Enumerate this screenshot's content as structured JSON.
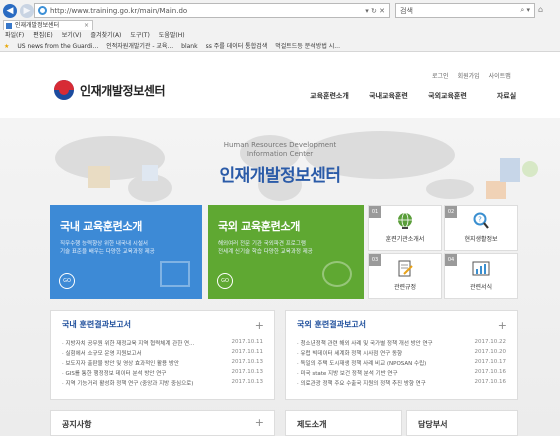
{
  "browser": {
    "url": "http://www.training.go.kr/main/Main.do",
    "search_query": "검색",
    "tab_title": "인재개발정보센터",
    "menu": [
      "파일(F)",
      "편집(E)",
      "보기(V)",
      "즐겨찾기(A)",
      "도구(T)",
      "도움말(H)"
    ],
    "favorites": [
      "US news from the Guardi...",
      "인적자원개발기관 - 교육...",
      "blank",
      "ss 주를 데이터 통합검색",
      "먹걸트드등 분석방법 시..."
    ]
  },
  "site": {
    "utility_links": [
      "로그인",
      "회원가입",
      "사이트맵"
    ],
    "logo_text": "인재개발정보센터",
    "gnb": [
      "교육훈련소개",
      "국내교육훈련",
      "국외교육훈련",
      "자료실"
    ],
    "hero_subtitle_1": "Human Resources Development",
    "hero_subtitle_2": "Information Center",
    "hero_title": "인재개발정보센터"
  },
  "boxes": {
    "domestic": {
      "title": "국내 교육훈련소개",
      "desc_1": "직무수행 능력향상 위한 내국내 시설서",
      "desc_2": "기술 표준을 배우는 다양한 교육과정 제공",
      "go": "GO"
    },
    "overseas": {
      "title": "국외 교육훈련소개",
      "desc_1": "해외여러 전문 기관 국외파견 프로그램",
      "desc_2": "전세계 신기술 학습 다양한 교육과정 제공",
      "go": "GO"
    }
  },
  "quick": [
    {
      "num": "01",
      "label": "훈련기관소개서"
    },
    {
      "num": "02",
      "label": "현지생활정보"
    },
    {
      "num": "03",
      "label": "관련규정"
    },
    {
      "num": "04",
      "label": "관련서식"
    }
  ],
  "panels": {
    "domestic_reports": {
      "title": "국내 훈련결과보고서",
      "rows": [
        {
          "title": "· 지방자치 공무원 위한 재정교육 지역 협력체계 관한 연...",
          "date": "2017.10.11"
        },
        {
          "title": "· 실험에서 소규모 운영 지원보고서",
          "date": "2017.10.11"
        },
        {
          "title": "· 보도지자 출판물 방안 및 영상 효과적인 활용 방안",
          "date": "2017.10.13"
        },
        {
          "title": "· GIS를 통한 행정정보 데이터 분석 방안 연구",
          "date": "2017.10.13"
        },
        {
          "title": "· 지역 기능거리 활성화 정책 연구 (중앙과 지방 중심으로)",
          "date": "2017.10.13"
        }
      ]
    },
    "overseas_reports": {
      "title": "국외 훈련결과보고서",
      "rows": [
        {
          "title": "· 청소년정책 관련 해외 사례 및 국가별 정책 개선 방안 연구",
          "date": "2017.10.22"
        },
        {
          "title": "· 유럽 빅데이터 세계화 정책 시사점 연구 동향",
          "date": "2017.10.20"
        },
        {
          "title": "· 독일의 주택 도시재생 정책 사례 비교 (NPOSAN 수립)",
          "date": "2017.10.17"
        },
        {
          "title": "· 미국 state 지방 보건 정책 분석 기반 연구",
          "date": "2017.10.16"
        },
        {
          "title": "· 의료관광 정책 주요 수출국 지원의 정책 추진 방향 연구",
          "date": "2017.10.16"
        }
      ]
    }
  },
  "bottom": {
    "notice": "공지사항",
    "system": "제도소개",
    "contact": "담당부서"
  }
}
